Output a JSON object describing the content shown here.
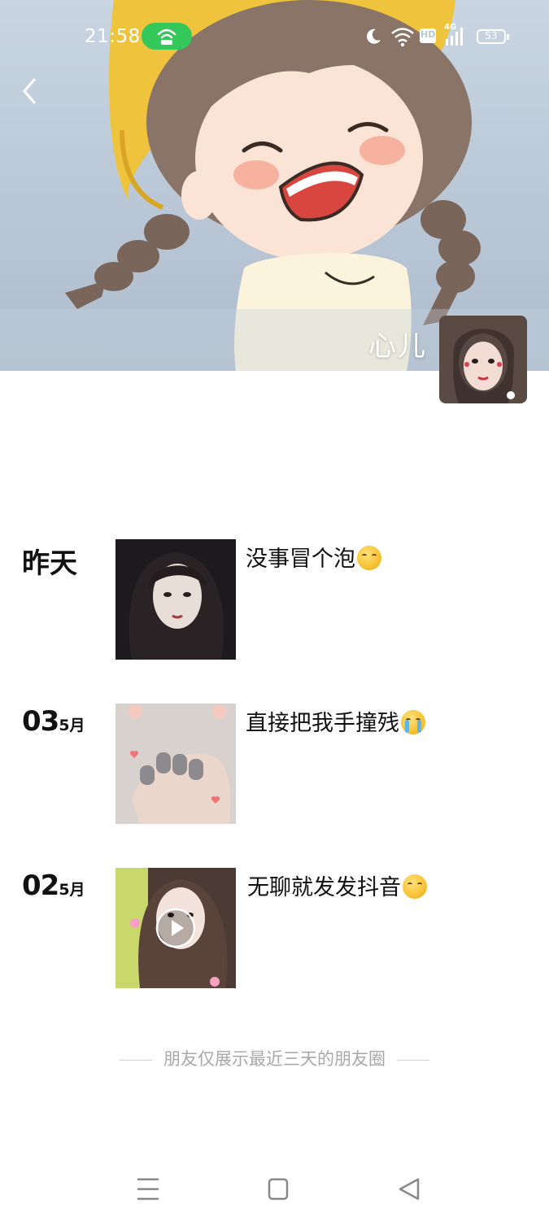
{
  "status_bar": {
    "time": "21:58",
    "network_badge": "HD",
    "signal_label": "4G",
    "battery": "53",
    "icons": [
      "hotspot-icon",
      "moon-icon",
      "wifi-icon",
      "hd-icon",
      "signal-icon",
      "battery-icon"
    ]
  },
  "header": {
    "back_icon": "chevron-left-icon",
    "profile_name": "心儿"
  },
  "posts": [
    {
      "date_label": "昨天",
      "day": "",
      "month": "",
      "caption": "没事冒个泡",
      "emoji": "thinking-face-emoji",
      "media": "photo"
    },
    {
      "date_label": "",
      "day": "03",
      "month": "5月",
      "caption": "直接把我手撞残",
      "emoji": "crying-face-emoji",
      "media": "photo"
    },
    {
      "date_label": "",
      "day": "02",
      "month": "5月",
      "caption": "无聊就发发抖音",
      "emoji": "thinking-face-emoji",
      "media": "video"
    }
  ],
  "footer_note": "朋友仅展示最近三天的朋友圈",
  "nav_bar": {
    "icons": [
      "menu-icon",
      "home-square-icon",
      "back-triangle-icon"
    ]
  },
  "colors": {
    "hotspot_green": "#34c759",
    "hat_yellow": "#f0c33c",
    "footer_text": "#a8a8a8"
  }
}
